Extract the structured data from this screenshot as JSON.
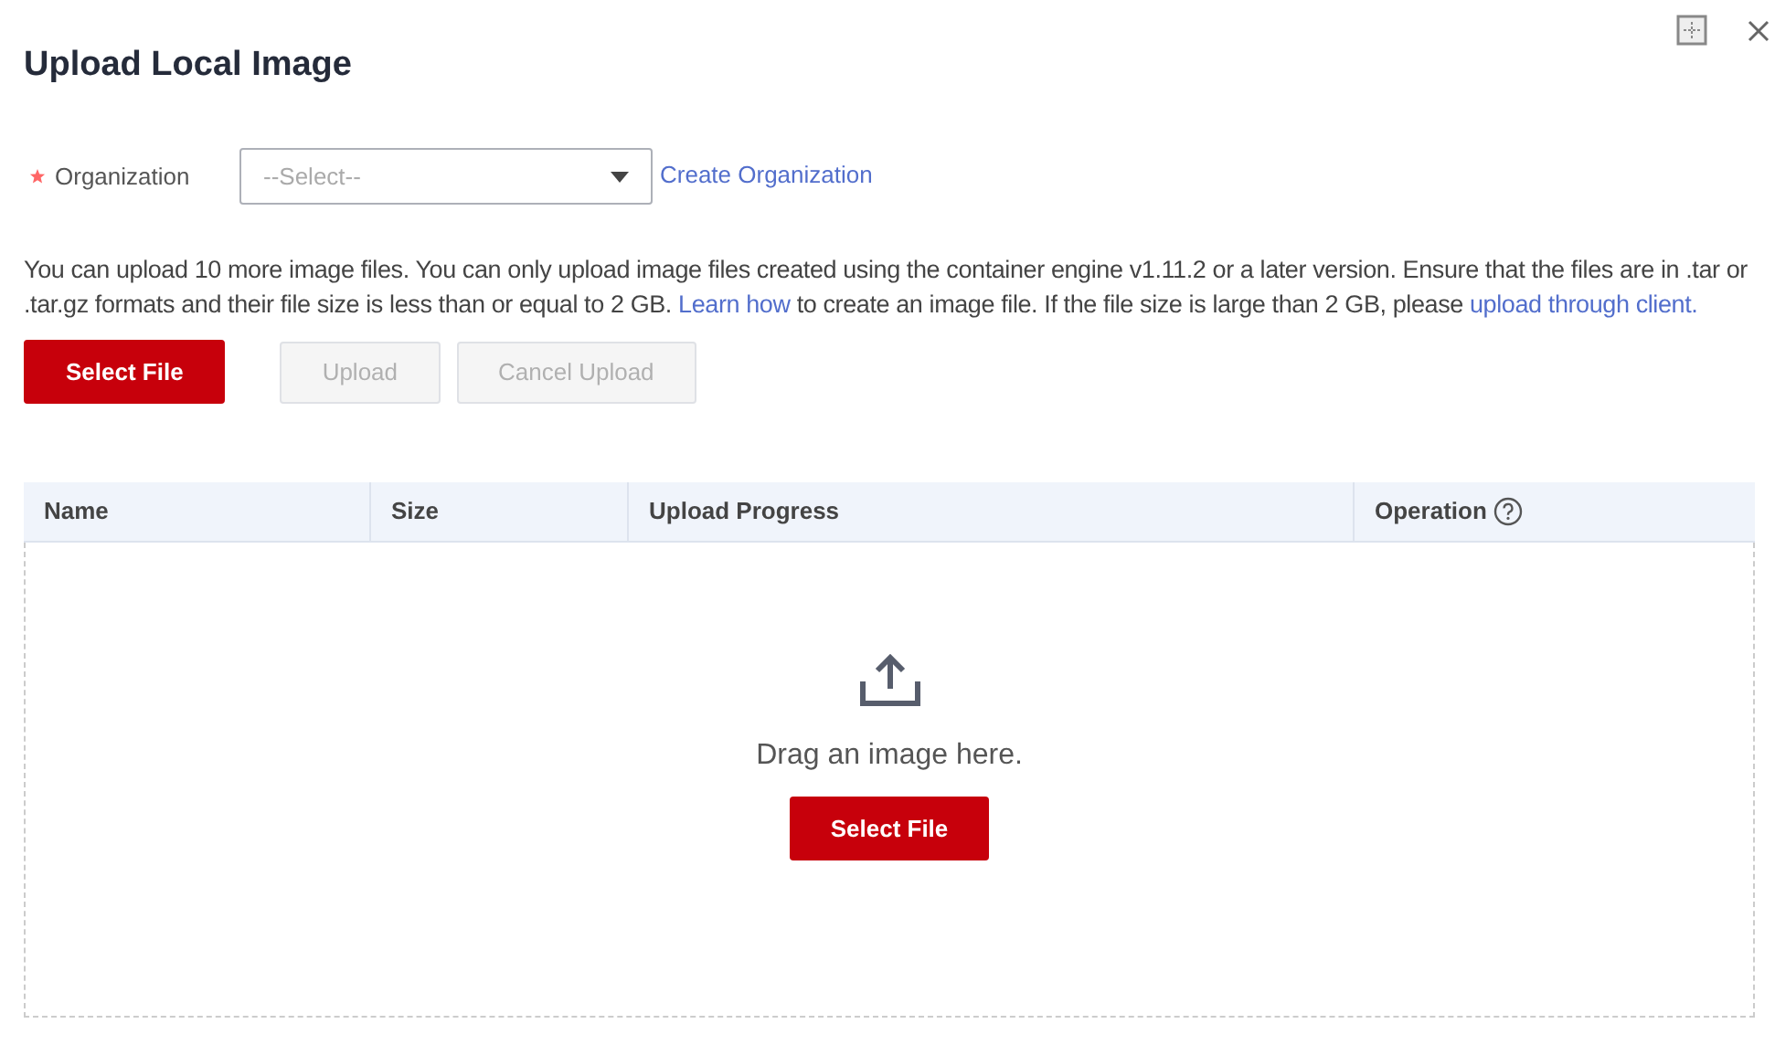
{
  "dialog": {
    "title": "Upload Local Image"
  },
  "organization": {
    "label": "Organization",
    "required": true,
    "placeholder": "--Select--",
    "link": "Create Organization"
  },
  "notice": [
    {
      "kind": "text",
      "text": "You can upload 10 more image files. You can only upload image files created using the container engine v1.11.2 or a later version. Ensure that the files are in .tar or .tar.gz formats and their file size is less than or equal to 2 GB. "
    },
    {
      "kind": "link",
      "text": "Learn how"
    },
    {
      "kind": "text",
      "text": " to create an image file. If the file size is large than 2 GB, please "
    },
    {
      "kind": "link",
      "text": "upload through client."
    }
  ],
  "buttons": [
    {
      "label": "Select File",
      "kind": "primary",
      "disabled": false
    },
    {
      "label": "Upload",
      "kind": "secondary",
      "disabled": true
    },
    {
      "label": "Cancel Upload",
      "kind": "secondary",
      "disabled": true
    }
  ],
  "table": {
    "columns": [
      {
        "label": "Name",
        "help": false
      },
      {
        "label": "Size",
        "help": false
      },
      {
        "label": "Upload Progress",
        "help": false
      },
      {
        "label": "Operation",
        "help": true
      }
    ]
  },
  "dropzone": {
    "text": "Drag an image here.",
    "button": "Select File"
  }
}
